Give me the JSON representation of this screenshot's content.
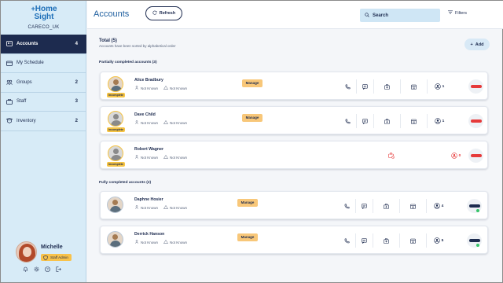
{
  "brand": {
    "logo_line1": "Home",
    "logo_line2": "Sight",
    "org": "CARECO_UK"
  },
  "sidebar": {
    "items": [
      {
        "label": "Accounts",
        "count": "4",
        "icon": "accounts-icon",
        "active": true
      },
      {
        "label": "My Schedule",
        "count": "",
        "icon": "calendar-icon"
      },
      {
        "label": "Groups",
        "count": "2",
        "icon": "groups-icon"
      },
      {
        "label": "Staff",
        "count": "3",
        "icon": "staff-icon"
      },
      {
        "label": "Inventory",
        "count": "2",
        "icon": "inventory-icon"
      }
    ]
  },
  "profile": {
    "name": "Michelle",
    "role": "Staff Admin"
  },
  "header": {
    "title": "Accounts",
    "refresh": "Refresh",
    "search": "Search",
    "filters": "Filters"
  },
  "main": {
    "total": "Total (5)",
    "sorted_note": "Accounts have been sorted by alphabetical order",
    "add": "Add",
    "section_partial": "Partially completed accounts (3)",
    "section_full": "Fully completed accounts (2)"
  },
  "accounts": [
    {
      "name": "Alice Bradbury",
      "meta1": "Not Known",
      "meta2": "Not Known",
      "badge": "Incomplete",
      "manage": "Manage",
      "count": "1",
      "toggle": "red"
    },
    {
      "name": "Dave Child",
      "meta1": "Not Known",
      "meta2": "Not Known",
      "badge": "Incomplete",
      "manage": "Manage",
      "count": "1",
      "toggle": "red"
    },
    {
      "name": "Robert Wagner",
      "meta1": "Not Known",
      "meta2": "Not Known",
      "badge": "Incomplete",
      "manage": "",
      "count": "0",
      "toggle": "red"
    },
    {
      "name": "Daphne Hosier",
      "meta1": "Not Known",
      "meta2": "Not Known",
      "badge": "",
      "manage": "Manage",
      "count": "4",
      "toggle": "dark"
    },
    {
      "name": "Derrick Hanson",
      "meta1": "Not Known",
      "meta2": "Not Known",
      "badge": "",
      "manage": "Manage",
      "count": "5",
      "toggle": "dark"
    }
  ],
  "colors": {
    "navy": "#1d2b4f",
    "accent": "#1f5f9f",
    "sidebar_bg": "#d7ebf7",
    "badge": "#f5c343",
    "manage": "#f8c779",
    "alert_red": "#e63a3a",
    "online_green": "#38c46a"
  }
}
